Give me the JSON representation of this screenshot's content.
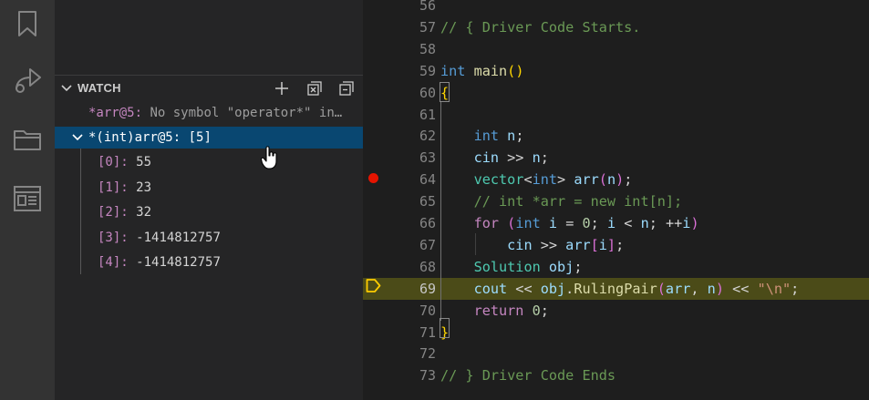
{
  "activity_bar": {
    "icons": [
      "bookmark-icon",
      "share-icon",
      "folder-icon",
      "window-icon"
    ]
  },
  "watch": {
    "title": "WATCH",
    "actions": [
      "add-expression-icon",
      "collapse-all-icon",
      "remove-all-icon"
    ],
    "error_item": {
      "name": "*arr@5:",
      "message": "No symbol \"operator*\" in…"
    },
    "selected_item": {
      "name": "*(int)arr@5:",
      "value": "[5]"
    },
    "children": [
      {
        "key": "[0]:",
        "value": "55"
      },
      {
        "key": "[1]:",
        "value": "23"
      },
      {
        "key": "[2]:",
        "value": "32"
      },
      {
        "key": "[3]:",
        "value": "-1414812757"
      },
      {
        "key": "[4]:",
        "value": "-1414812757"
      }
    ]
  },
  "editor": {
    "current_line": "69",
    "breakpoint_line": "64",
    "lines": [
      {
        "n": "56",
        "tokens": []
      },
      {
        "n": "57",
        "tokens": [
          [
            "cmt",
            "// { Driver Code Starts."
          ]
        ]
      },
      {
        "n": "58",
        "tokens": []
      },
      {
        "n": "59",
        "tokens": [
          [
            "kw",
            "int"
          ],
          [
            "op",
            " "
          ],
          [
            "fn",
            "main"
          ],
          [
            "b1",
            "()"
          ]
        ]
      },
      {
        "n": "60",
        "tokens": [
          [
            "b1",
            "{"
          ]
        ]
      },
      {
        "n": "61",
        "tokens": []
      },
      {
        "n": "62",
        "tokens": [
          [
            "op",
            "    "
          ],
          [
            "kw",
            "int"
          ],
          [
            "op",
            " "
          ],
          [
            "var",
            "n"
          ],
          [
            "op",
            ";"
          ]
        ]
      },
      {
        "n": "63",
        "tokens": [
          [
            "op",
            "    "
          ],
          [
            "var",
            "cin"
          ],
          [
            "op",
            " >> "
          ],
          [
            "var",
            "n"
          ],
          [
            "op",
            ";"
          ]
        ]
      },
      {
        "n": "64",
        "tokens": [
          [
            "op",
            "    "
          ],
          [
            "type",
            "vector"
          ],
          [
            "op",
            "<"
          ],
          [
            "kw",
            "int"
          ],
          [
            "op",
            "> "
          ],
          [
            "var",
            "arr"
          ],
          [
            "b2",
            "("
          ],
          [
            "var",
            "n"
          ],
          [
            "b2",
            ")"
          ],
          [
            "op",
            ";"
          ]
        ]
      },
      {
        "n": "65",
        "tokens": [
          [
            "op",
            "    "
          ],
          [
            "cmt",
            "// int *arr = new int[n];"
          ]
        ]
      },
      {
        "n": "66",
        "tokens": [
          [
            "op",
            "    "
          ],
          [
            "ctrl",
            "for"
          ],
          [
            "op",
            " "
          ],
          [
            "b2",
            "("
          ],
          [
            "kw",
            "int"
          ],
          [
            "op",
            " "
          ],
          [
            "var",
            "i"
          ],
          [
            "op",
            " = "
          ],
          [
            "num",
            "0"
          ],
          [
            "op",
            "; "
          ],
          [
            "var",
            "i"
          ],
          [
            "op",
            " < "
          ],
          [
            "var",
            "n"
          ],
          [
            "op",
            "; ++"
          ],
          [
            "var",
            "i"
          ],
          [
            "b2",
            ")"
          ]
        ]
      },
      {
        "n": "67",
        "tokens": [
          [
            "op",
            "        "
          ],
          [
            "var",
            "cin"
          ],
          [
            "op",
            " >> "
          ],
          [
            "var",
            "arr"
          ],
          [
            "b2",
            "["
          ],
          [
            "var",
            "i"
          ],
          [
            "b2",
            "]"
          ],
          [
            "op",
            ";"
          ]
        ]
      },
      {
        "n": "68",
        "tokens": [
          [
            "op",
            "    "
          ],
          [
            "type",
            "Solution"
          ],
          [
            "op",
            " "
          ],
          [
            "var",
            "obj"
          ],
          [
            "op",
            ";"
          ]
        ]
      },
      {
        "n": "69",
        "tokens": [
          [
            "op",
            "    "
          ],
          [
            "var",
            "cout"
          ],
          [
            "op",
            " << "
          ],
          [
            "var",
            "obj"
          ],
          [
            "op",
            "."
          ],
          [
            "fn",
            "RulingPair"
          ],
          [
            "b2",
            "("
          ],
          [
            "var",
            "arr"
          ],
          [
            "op",
            ", "
          ],
          [
            "var",
            "n"
          ],
          [
            "b2",
            ")"
          ],
          [
            "op",
            " << "
          ],
          [
            "str",
            "\"\\n\""
          ],
          [
            "op",
            ";"
          ]
        ]
      },
      {
        "n": "70",
        "tokens": [
          [
            "op",
            "    "
          ],
          [
            "ctrl",
            "return"
          ],
          [
            "op",
            " "
          ],
          [
            "num",
            "0"
          ],
          [
            "op",
            ";"
          ]
        ]
      },
      {
        "n": "71",
        "tokens": [
          [
            "b1",
            "}"
          ]
        ]
      },
      {
        "n": "72",
        "tokens": []
      },
      {
        "n": "73",
        "tokens": [
          [
            "cmt",
            "// } Driver Code Ends"
          ]
        ]
      }
    ]
  }
}
